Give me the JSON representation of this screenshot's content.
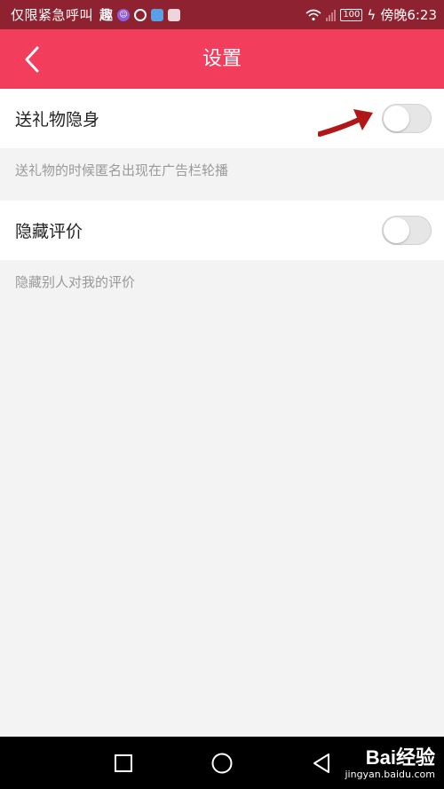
{
  "status_bar": {
    "carrier": "仅限紧急呼叫",
    "notification_char": "趣",
    "battery": "100",
    "time": "傍晚6:23"
  },
  "header": {
    "title": "设置",
    "back_icon": "chevron-left-icon",
    "background_color": "#f23d5c"
  },
  "settings": [
    {
      "label": "送礼物隐身",
      "description": "送礼物的时候匿名出现在广告栏轮播",
      "enabled": false
    },
    {
      "label": "隐藏评价",
      "description": "隐藏别人对我的评价",
      "enabled": false
    }
  ],
  "annotation": {
    "icon": "red-arrow-icon",
    "color": "#b01818"
  },
  "nav_bar": {
    "icons": [
      "recent-apps-icon",
      "home-icon",
      "back-icon"
    ]
  },
  "watermark": {
    "main": "Bai经验",
    "sub": "jingyan.baidu.com"
  }
}
